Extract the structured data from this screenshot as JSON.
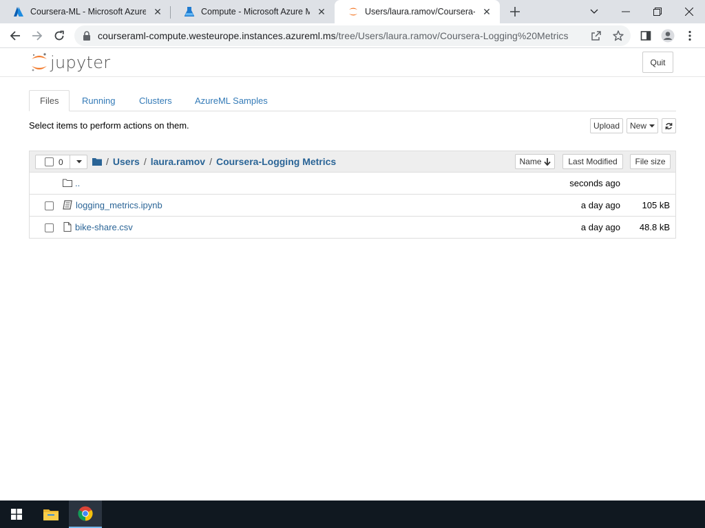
{
  "browser": {
    "tabs": [
      {
        "title": "Coursera-ML - Microsoft Azure",
        "icon": "azure-icon"
      },
      {
        "title": "Compute - Microsoft Azure Machine Learning",
        "icon": "azureml-icon"
      },
      {
        "title": "Users/laura.ramov/Coursera-Logging Metrics/",
        "icon": "jupyter-icon"
      }
    ],
    "url_host": "courseraml-compute.westeurope.instances.azureml.ms",
    "url_path": "/tree/Users/laura.ramov/Coursera-Logging%20Metrics"
  },
  "jupyter": {
    "logo_text": "jupyter",
    "quit_label": "Quit",
    "tabs": [
      "Files",
      "Running",
      "Clusters",
      "AzureML Samples"
    ],
    "hint": "Select items to perform actions on them.",
    "upload_label": "Upload",
    "new_label": "New",
    "selected_count": "0",
    "breadcrumb": [
      "Users",
      "laura.ramov",
      "Coursera-Logging Metrics"
    ],
    "columns": {
      "name": "Name",
      "modified": "Last Modified",
      "size": "File size"
    },
    "parent_dir": {
      "name": "..",
      "modified": "seconds ago"
    },
    "items": [
      {
        "name": "logging_metrics.ipynb",
        "modified": "a day ago",
        "size": "105 kB",
        "icon": "notebook-icon"
      },
      {
        "name": "bike-share.csv",
        "modified": "a day ago",
        "size": "48.8 kB",
        "icon": "file-icon"
      }
    ]
  },
  "colors": {
    "link": "#2a6496",
    "tab_link": "#337ab7",
    "jupyter_orange": "#f37726",
    "taskbar": "#101820"
  }
}
